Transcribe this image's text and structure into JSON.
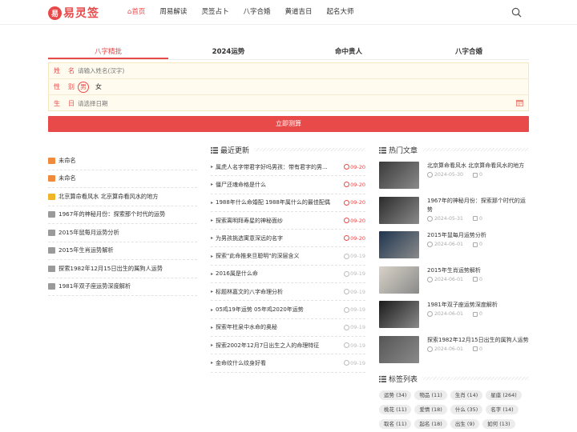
{
  "header": {
    "logo_mark": "易",
    "logo_text": "易灵签",
    "nav": [
      "首页",
      "周易解读",
      "灵签占卜",
      "八字合婚",
      "黄道吉日",
      "起名大师"
    ]
  },
  "tabs": [
    "八字精批",
    "2024运势",
    "命中贵人",
    "八字合婚"
  ],
  "form": {
    "name_label": [
      "姓",
      "名"
    ],
    "name_placeholder": "请输入姓名(汉字)",
    "gender_label": [
      "性",
      "别"
    ],
    "gender_male": "男",
    "gender_female": "女",
    "birth_label": [
      "生",
      "日"
    ],
    "birth_placeholder": "请选择日期",
    "submit": "立即测算"
  },
  "left_list": [
    {
      "text": "未命名",
      "badge": "orange"
    },
    {
      "text": "未命名",
      "badge": "orange"
    },
    {
      "text": "北京算命看风水 北京算命看风水的地方",
      "badge": "gold"
    },
    {
      "text": "1967年的神秘月份：探索那个时代的运势",
      "badge": "gray"
    },
    {
      "text": "2015年鼠每月运势分析",
      "badge": "gray"
    },
    {
      "text": "2015年生肖运势解析",
      "badge": "gray"
    },
    {
      "text": "探索1982年12月15日出生的属狗人运势",
      "badge": "gray"
    },
    {
      "text": "1981年双子座运势深度解析",
      "badge": "gray"
    }
  ],
  "latest": {
    "title": "最近更新",
    "items": [
      {
        "text": "属虎人名字带君字好吗男孩：带有君字的男...",
        "date": "09-20",
        "hot": true
      },
      {
        "text": "僵尸还魂命格是什么",
        "date": "09-20",
        "hot": true
      },
      {
        "text": "1988年什么命婚配 1988年属什么的最佳配偶",
        "date": "09-20",
        "hot": true
      },
      {
        "text": "探索离明拜寿星的神秘面纱",
        "date": "09-20",
        "hot": true
      },
      {
        "text": "为男孩挑选寓意深远的名字",
        "date": "09-20",
        "hot": true
      },
      {
        "text": "探索\"此命推来旦聪明\"的深层含义",
        "date": "09-19",
        "hot": false
      },
      {
        "text": "2016属是什么命",
        "date": "09-19",
        "hot": false
      },
      {
        "text": "标题林嘉文的八字命理分析",
        "date": "09-19",
        "hot": false
      },
      {
        "text": "05鸡19年运势 05年鸡2020年运势",
        "date": "09-19",
        "hot": false
      },
      {
        "text": "探索年柱泉中水命的奥秘",
        "date": "09-19",
        "hot": false
      },
      {
        "text": "探索2002年12月7日出生之人的命理特征",
        "date": "09-19",
        "hot": false
      },
      {
        "text": "金命纹什么纹身好看",
        "date": "09-19",
        "hot": false
      }
    ]
  },
  "hot_articles": {
    "title": "热门文章",
    "items": [
      {
        "title": "北京算命看风水 北京算命看风水的地方",
        "date": "2024-05-30",
        "comments": "0",
        "thumb": "#3a3a3a"
      },
      {
        "title": "1967年的神秘月份：探索那个时代的运势",
        "date": "2024-05-31",
        "comments": "0",
        "thumb": "#2b2b2b"
      },
      {
        "title": "2015年鼠每月运势分析",
        "date": "2024-06-01",
        "comments": "0",
        "thumb": "#1f3550"
      },
      {
        "title": "2015年生肖运势解析",
        "date": "2024-06-01",
        "comments": "0",
        "thumb": "#d8d3c8"
      },
      {
        "title": "1981年双子座运势深度解析",
        "date": "2024-06-01",
        "comments": "0",
        "thumb": "#1a1a1a"
      },
      {
        "title": "探索1982年12月15日出生的属狗人运势",
        "date": "2024-06-01",
        "comments": "0",
        "thumb": "#555555"
      }
    ]
  },
  "tags": {
    "title": "标签列表",
    "items": [
      "运势 (34)",
      "物品 (11)",
      "生肖 (14)",
      "星座 (264)",
      "桃花 (11)",
      "爱情 (18)",
      "什么 (35)",
      "名字 (14)",
      "取名 (11)",
      "起名 (18)",
      "出生 (9)",
      "如何 (13)"
    ]
  },
  "colors": {
    "accent": "#e84a4a",
    "form_bg": "#fffbef"
  }
}
